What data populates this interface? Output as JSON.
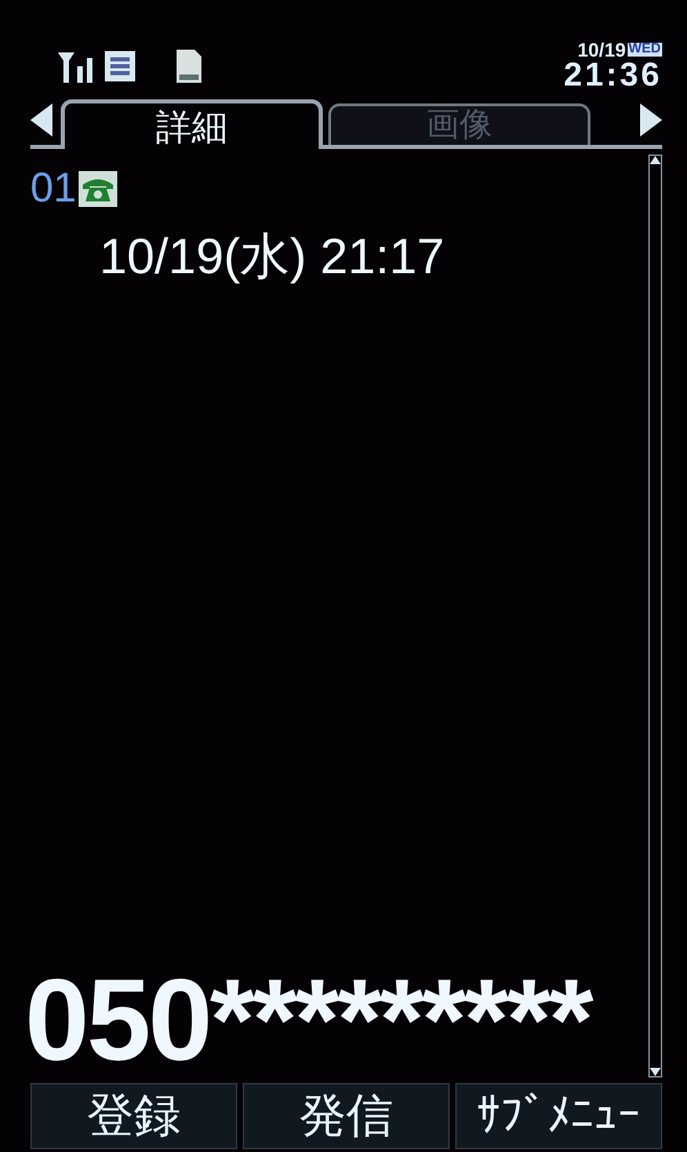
{
  "status_bar": {
    "date": "10/19",
    "weekday": "WED",
    "time": "21:36"
  },
  "tabs": [
    {
      "label": "詳細",
      "selected": true
    },
    {
      "label": "画像",
      "selected": false
    }
  ],
  "entry": {
    "index": "01",
    "datetime": "10/19(水) 21:17"
  },
  "number": "050*********",
  "softkeys": [
    "登録",
    "発信",
    "ｻﾌﾞﾒﾆｭｰ"
  ]
}
